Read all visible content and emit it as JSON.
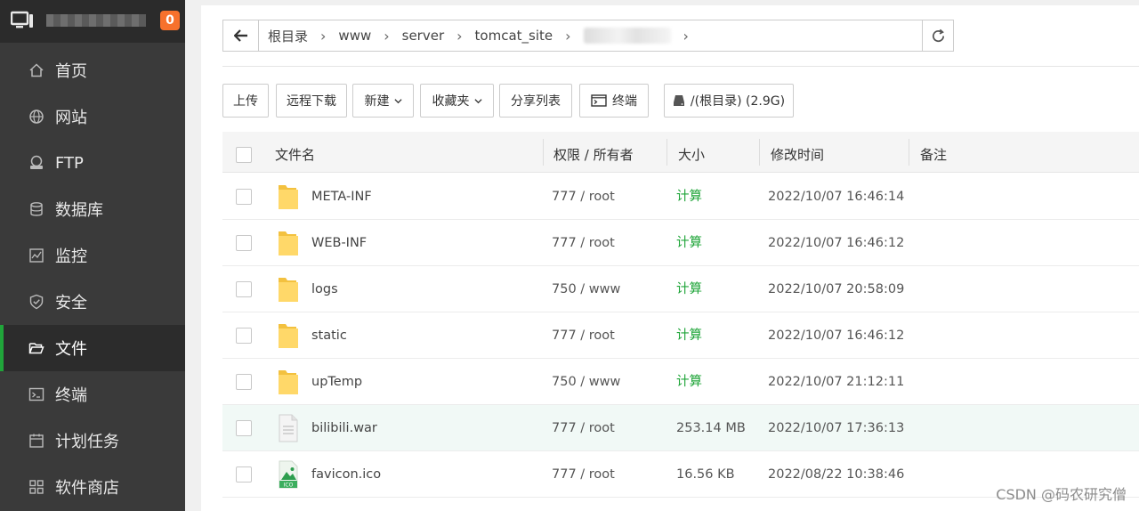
{
  "sidebar": {
    "badge": "0",
    "items": [
      {
        "label": "首页",
        "icon": "home-icon",
        "active": false
      },
      {
        "label": "网站",
        "icon": "globe-icon",
        "active": false
      },
      {
        "label": "FTP",
        "icon": "ftp-icon",
        "active": false
      },
      {
        "label": "数据库",
        "icon": "database-icon",
        "active": false
      },
      {
        "label": "监控",
        "icon": "monitor-chart-icon",
        "active": false
      },
      {
        "label": "安全",
        "icon": "shield-icon",
        "active": false
      },
      {
        "label": "文件",
        "icon": "folder-open-icon",
        "active": true
      },
      {
        "label": "终端",
        "icon": "terminal-icon",
        "active": false
      },
      {
        "label": "计划任务",
        "icon": "calendar-icon",
        "active": false
      },
      {
        "label": "软件商店",
        "icon": "apps-grid-icon",
        "active": false
      }
    ]
  },
  "path": {
    "crumbs": [
      "根目录",
      "www",
      "server",
      "tomcat_site"
    ]
  },
  "toolbar": {
    "upload": "上传",
    "remote_download": "远程下载",
    "new": "新建",
    "favorites": "收藏夹",
    "share_list": "分享列表",
    "terminal": "终端",
    "disk": "/(根目录) (2.9G)"
  },
  "table": {
    "headers": {
      "name": "文件名",
      "perm": "权限 / 所有者",
      "size": "大小",
      "mtime": "修改时间",
      "note": "备注"
    },
    "rows": [
      {
        "name": "META-INF",
        "type": "folder",
        "perm": "777 / root",
        "size": "计算",
        "mtime": "2022/10/07 16:46:14"
      },
      {
        "name": "WEB-INF",
        "type": "folder",
        "perm": "777 / root",
        "size": "计算",
        "mtime": "2022/10/07 16:46:12"
      },
      {
        "name": "logs",
        "type": "folder",
        "perm": "750 / www",
        "size": "计算",
        "mtime": "2022/10/07 20:58:09"
      },
      {
        "name": "static",
        "type": "folder",
        "perm": "777 / root",
        "size": "计算",
        "mtime": "2022/10/07 16:46:12"
      },
      {
        "name": "upTemp",
        "type": "folder",
        "perm": "750 / www",
        "size": "计算",
        "mtime": "2022/10/07 21:12:11"
      },
      {
        "name": "bilibili.war",
        "type": "file",
        "perm": "777 / root",
        "size": "253.14 MB",
        "mtime": "2022/10/07 17:36:13"
      },
      {
        "name": "favicon.ico",
        "type": "image",
        "perm": "777 / root",
        "size": "16.56 KB",
        "mtime": "2022/08/22 10:38:46"
      }
    ]
  },
  "watermark": "CSDN @码农研究僧",
  "colors": {
    "accent": "#20a53a",
    "badge": "#f7712c",
    "sidebar": "#3a3a3a"
  }
}
